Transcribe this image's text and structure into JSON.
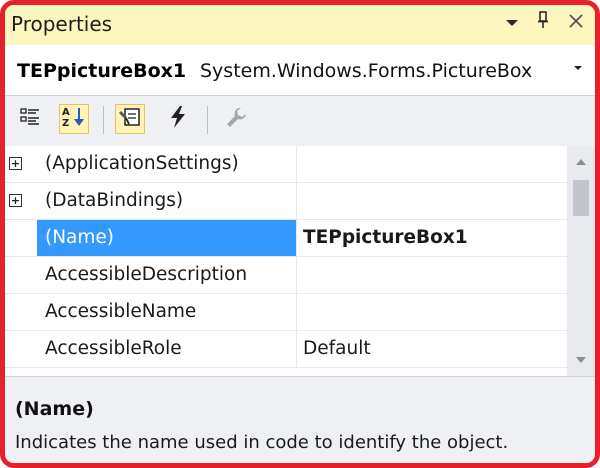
{
  "window": {
    "title": "Properties",
    "dropdown_icon": "dropdown-arrow-icon",
    "pin_icon": "pin-icon",
    "close_icon": "close-icon"
  },
  "selector": {
    "object_name": "TEPpictureBox1",
    "object_type": "System.Windows.Forms.PictureBox"
  },
  "toolbar": {
    "buttons": [
      {
        "name": "categorized-view",
        "icon": "categorized-icon",
        "active": false
      },
      {
        "name": "alphabetical-view",
        "icon": "sort-az-icon",
        "active": true
      },
      {
        "name": "properties-view",
        "icon": "properties-icon",
        "active": true
      },
      {
        "name": "events-view",
        "icon": "lightning-icon",
        "active": false
      },
      {
        "name": "property-pages",
        "icon": "wrench-icon",
        "active": false
      }
    ]
  },
  "grid": {
    "rows": [
      {
        "name": "(ApplicationSettings)",
        "value": "",
        "expandable": true,
        "selected": false,
        "bold_value": false
      },
      {
        "name": "(DataBindings)",
        "value": "",
        "expandable": true,
        "selected": false,
        "bold_value": false
      },
      {
        "name": "(Name)",
        "value": "TEPpictureBox1",
        "expandable": false,
        "selected": true,
        "bold_value": true
      },
      {
        "name": "AccessibleDescription",
        "value": "",
        "expandable": false,
        "selected": false,
        "bold_value": false
      },
      {
        "name": "AccessibleName",
        "value": "",
        "expandable": false,
        "selected": false,
        "bold_value": false
      },
      {
        "name": "AccessibleRole",
        "value": "Default",
        "expandable": false,
        "selected": false,
        "bold_value": false
      }
    ],
    "expander_glyph": "+"
  },
  "description": {
    "title": "(Name)",
    "text": "Indicates the name used in code to identify the object."
  },
  "colors": {
    "highlight_border": "#e8202a",
    "title_background": "#fef6bf",
    "selection": "#3399ff",
    "active_tool": "#fff3b8"
  }
}
